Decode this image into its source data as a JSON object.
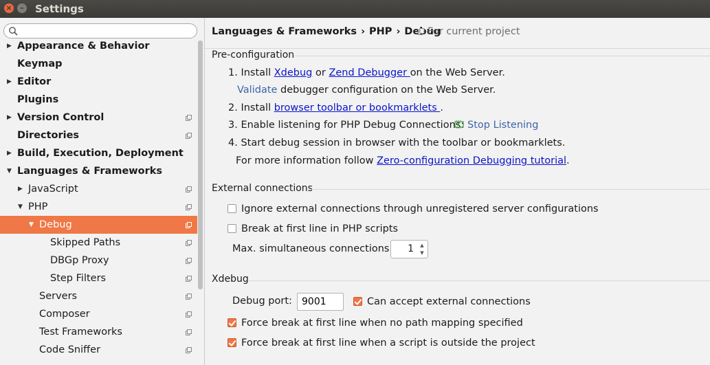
{
  "window": {
    "title": "Settings",
    "close_glyph": "×",
    "min_glyph": "–"
  },
  "search": {
    "value": "",
    "placeholder": ""
  },
  "tree": [
    {
      "label": "Appearance & Behavior",
      "bold": true,
      "arrow": "right",
      "indent": 0,
      "project": false
    },
    {
      "label": "Keymap",
      "bold": true,
      "arrow": "",
      "indent": 0,
      "project": false
    },
    {
      "label": "Editor",
      "bold": true,
      "arrow": "right",
      "indent": 0,
      "project": false
    },
    {
      "label": "Plugins",
      "bold": true,
      "arrow": "",
      "indent": 0,
      "project": false
    },
    {
      "label": "Version Control",
      "bold": true,
      "arrow": "right",
      "indent": 0,
      "project": true
    },
    {
      "label": "Directories",
      "bold": true,
      "arrow": "",
      "indent": 0,
      "project": true
    },
    {
      "label": "Build, Execution, Deployment",
      "bold": true,
      "arrow": "right",
      "indent": 0,
      "project": false
    },
    {
      "label": "Languages & Frameworks",
      "bold": true,
      "arrow": "down",
      "indent": 0,
      "project": false
    },
    {
      "label": "JavaScript",
      "bold": false,
      "arrow": "right",
      "indent": 1,
      "project": true
    },
    {
      "label": "PHP",
      "bold": false,
      "arrow": "down",
      "indent": 1,
      "project": true
    },
    {
      "label": "Debug",
      "bold": false,
      "arrow": "down",
      "indent": 2,
      "project": true,
      "selected": true
    },
    {
      "label": "Skipped Paths",
      "bold": false,
      "arrow": "",
      "indent": 3,
      "project": true
    },
    {
      "label": "DBGp Proxy",
      "bold": false,
      "arrow": "",
      "indent": 3,
      "project": true
    },
    {
      "label": "Step Filters",
      "bold": false,
      "arrow": "",
      "indent": 3,
      "project": true
    },
    {
      "label": "Servers",
      "bold": false,
      "arrow": "",
      "indent": 2,
      "project": true
    },
    {
      "label": "Composer",
      "bold": false,
      "arrow": "",
      "indent": 2,
      "project": true
    },
    {
      "label": "Test Frameworks",
      "bold": false,
      "arrow": "",
      "indent": 2,
      "project": true
    },
    {
      "label": "Code Sniffer",
      "bold": false,
      "arrow": "",
      "indent": 2,
      "project": true
    }
  ],
  "breadcrumb": {
    "part1": "Languages & Frameworks",
    "part2": "PHP",
    "part3": "Debug",
    "sep": "›",
    "scope": "For current project"
  },
  "preconfig": {
    "title": "Pre-configuration",
    "step1_prefix": "1. Install ",
    "xdebug_link": "Xdebug",
    "or": " or ",
    "zend_link": "Zend Debugger ",
    "step1_suffix": " on the Web Server.",
    "validate_link": "Validate",
    "validate_suffix": " debugger configuration on the Web Server.",
    "step2_prefix": "2. Install ",
    "toolbar_link": "browser toolbar or bookmarklets ",
    "step2_suffix": ".",
    "step3": "3. Enable listening for PHP Debug Connections:",
    "stop_listening": "Stop Listening",
    "step4": "4. Start debug session in browser with the toolbar or bookmarklets.",
    "more_prefix": "For more information follow ",
    "tutorial_link": "Zero-configuration Debugging tutorial",
    "more_suffix": "."
  },
  "external": {
    "title": "External connections",
    "ignore_label": "Ignore external connections through unregistered server configurations",
    "ignore_checked": false,
    "break_label": "Break at first line in PHP scripts",
    "break_checked": false,
    "max_label": "Max. simultaneous connections:",
    "max_value": "1",
    "spin_up": "▲",
    "spin_down": "▼"
  },
  "xdebug": {
    "title": "Xdebug",
    "port_label": "Debug port:",
    "port_value": "9001",
    "accept_label": "Can accept external connections",
    "accept_checked": true,
    "force_mapping_label": "Force break at first line when no path mapping specified",
    "force_mapping_checked": true,
    "force_outside_label": "Force break at first line when a script is outside the project",
    "force_outside_checked": true
  },
  "colors": {
    "accent": "#f07746",
    "link": "#0b14c8",
    "titlebar": "#3c3b37"
  }
}
